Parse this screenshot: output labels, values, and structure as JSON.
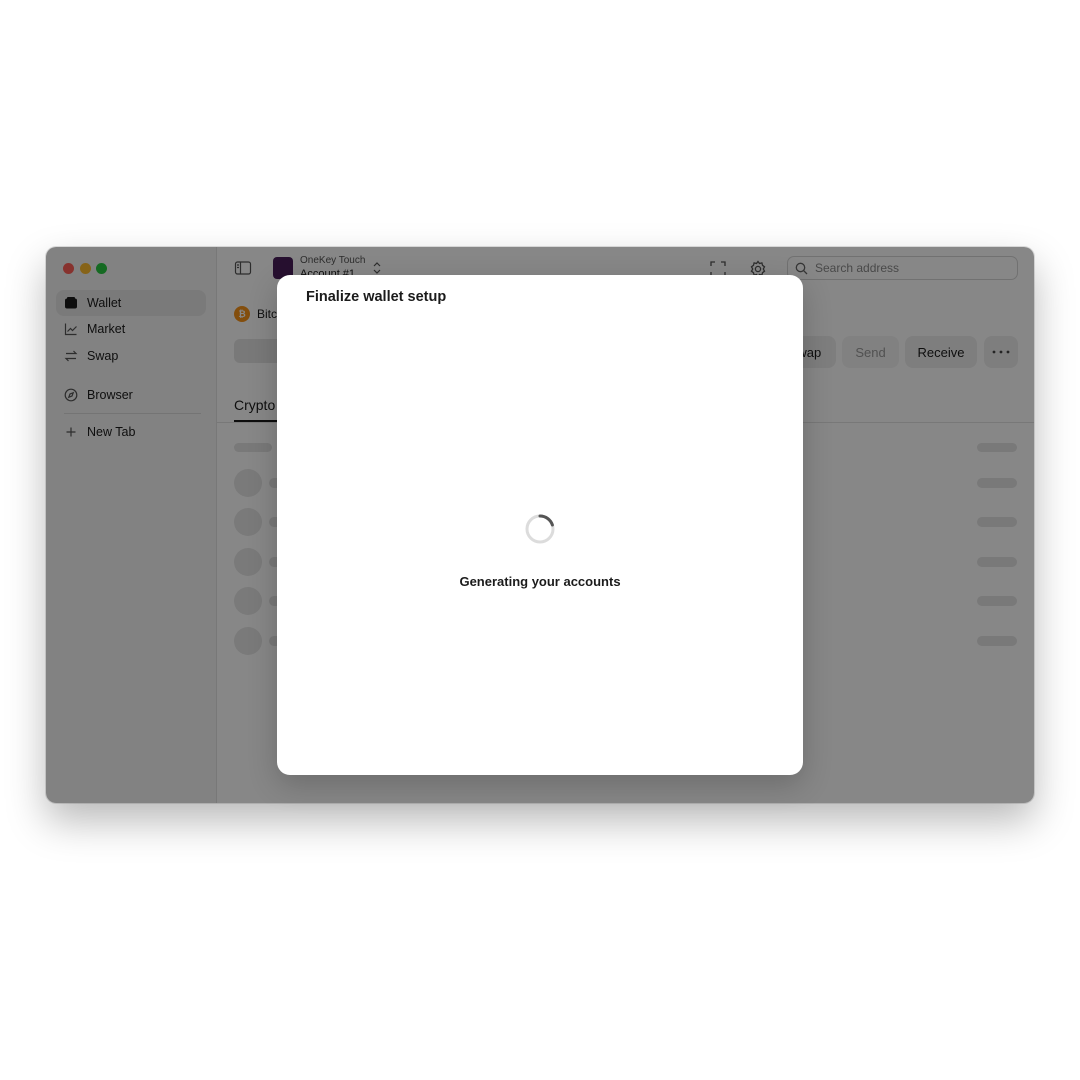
{
  "sidebar": {
    "items": [
      {
        "label": "Wallet",
        "icon": "wallet-icon",
        "active": true
      },
      {
        "label": "Market",
        "icon": "chart-icon",
        "active": false
      },
      {
        "label": "Swap",
        "icon": "swap-icon",
        "active": false
      },
      {
        "label": "Browser",
        "icon": "compass-icon",
        "active": false
      },
      {
        "label": "New Tab",
        "icon": "plus-icon",
        "active": false
      }
    ]
  },
  "header": {
    "wallet_name": "OneKey Touch",
    "account_name": "Account #1",
    "search_placeholder": "Search address"
  },
  "network": {
    "label": "Bitcoin"
  },
  "actions": {
    "swap": "Swap",
    "send": "Send",
    "receive": "Receive"
  },
  "tabs": {
    "crypto": "Crypto"
  },
  "modal": {
    "title": "Finalize wallet setup",
    "status": "Generating your accounts"
  },
  "colors": {
    "bitcoin": "#f7931a",
    "wallet_avatar": "#4a1f5c",
    "scrim": "rgba(0,0,0,0.47)"
  }
}
